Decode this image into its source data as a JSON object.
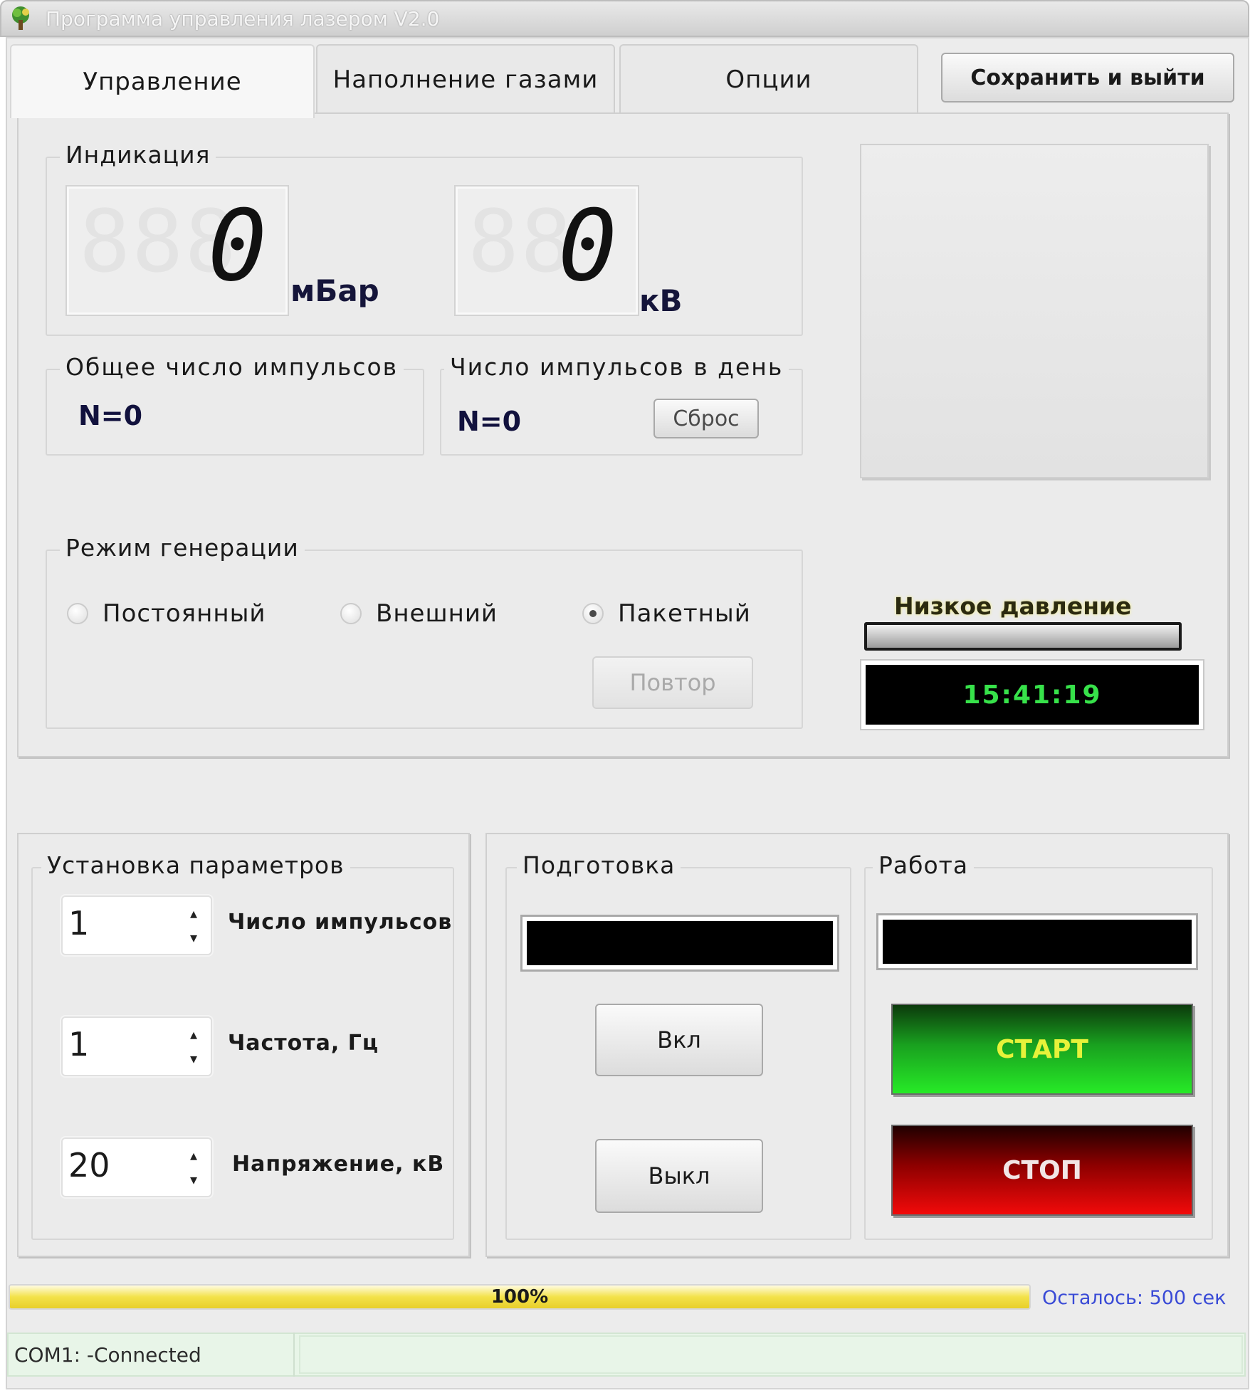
{
  "window": {
    "title": "Программа управления лазером V2.0",
    "icon": "app-tree-icon"
  },
  "tabs": [
    {
      "label": "Управление",
      "active": true
    },
    {
      "label": "Наполнение газами",
      "active": false
    },
    {
      "label": "Опции",
      "active": false
    }
  ],
  "save_exit_label": "Сохранить и выйти",
  "indication": {
    "legend": "Индикация",
    "pressure": {
      "ghost": "888",
      "value": "0",
      "unit": "мБар"
    },
    "voltage": {
      "ghost": "88",
      "value": "0",
      "unit": "кВ"
    }
  },
  "total_pulses": {
    "legend": "Общее число импульсов",
    "value": "N=0"
  },
  "daily_pulses": {
    "legend": "Число импульсов в день",
    "value": "N=0",
    "reset_label": "Сброс"
  },
  "generation_mode": {
    "legend": "Режим генерации",
    "options": [
      {
        "label": "Постоянный",
        "checked": false
      },
      {
        "label": "Внешний",
        "checked": false
      },
      {
        "label": "Пакетный",
        "checked": true
      }
    ],
    "repeat_label": "Повтор"
  },
  "low_pressure": {
    "label": "Низкое давление"
  },
  "clock": {
    "time": "15:41:19",
    "color": "#37e24a"
  },
  "parameters": {
    "legend": "Установка параметров",
    "fields": [
      {
        "value": "1",
        "label": "Число импульсов"
      },
      {
        "value": "1",
        "label": "Частота, Гц"
      },
      {
        "value": "20",
        "label": "Напряжение, кВ"
      }
    ]
  },
  "preparation": {
    "legend": "Подготовка",
    "on_label": "Вкл",
    "off_label": "Выкл"
  },
  "work": {
    "legend": "Работа",
    "start_label": "СТАРТ",
    "stop_label": "СТОП",
    "start_text_color": "#e6f23a",
    "stop_text_color": "#f2e6e6"
  },
  "progress": {
    "percent_text": "100%",
    "fraction": 1.0,
    "remaining": "Осталось: 500 сек"
  },
  "status_bar": {
    "port_status": "COM1: -Connected"
  }
}
